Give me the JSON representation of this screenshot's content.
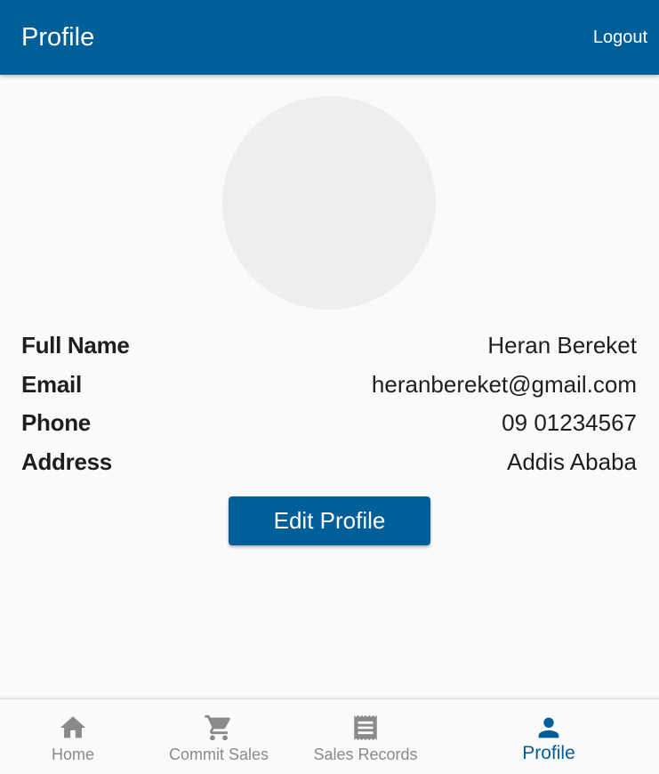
{
  "appbar": {
    "title": "Profile",
    "logout_label": "Logout",
    "color": "#005f98"
  },
  "profile": {
    "fields": [
      {
        "label": "Full Name",
        "value": "Heran Bereket"
      },
      {
        "label": "Email",
        "value": "heranbereket@gmail.com"
      },
      {
        "label": "Phone",
        "value": "09 01234567"
      },
      {
        "label": "Address",
        "value": "Addis Ababa"
      }
    ],
    "edit_label": "Edit Profile"
  },
  "bottom_nav": {
    "items": [
      {
        "label": "Home",
        "icon": "home-icon",
        "active": false
      },
      {
        "label": "Commit Sales",
        "icon": "cart-icon",
        "active": false
      },
      {
        "label": "Sales Records",
        "icon": "receipt-icon",
        "active": false
      },
      {
        "label": "Profile",
        "icon": "person-icon",
        "active": true
      }
    ],
    "active_color": "#005f98",
    "inactive_color": "#8a8a8a"
  }
}
